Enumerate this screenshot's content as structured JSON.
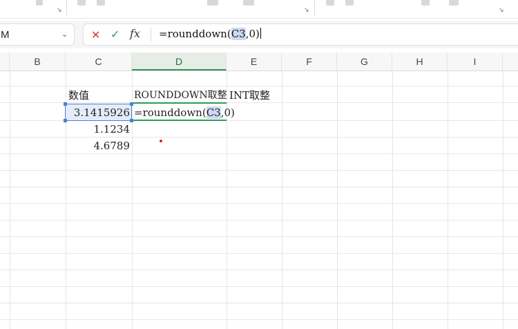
{
  "namebox": {
    "value": "M",
    "chevron_icon": "chevron-down-icon"
  },
  "formula_bar": {
    "cancel_icon": "x-icon",
    "confirm_icon": "check-icon",
    "fx_label": "fx",
    "formula_prefix": "=rounddown(",
    "formula_ref": "C3",
    "formula_suffix": ",0)"
  },
  "columns": [
    "B",
    "C",
    "D",
    "E",
    "F",
    "G",
    "H",
    "I"
  ],
  "active_column": "D",
  "cells": {
    "c_header": "数值",
    "d_header": "ROUNDDOWN取整",
    "e_header": "INT取整",
    "c3": "3.1415926",
    "c4": "1.1234",
    "c5": "4.6789",
    "d3_prefix": "=rounddown(",
    "d3_ref": "C3",
    "d3_suffix": ",0)"
  },
  "colors": {
    "selection": "#4a7ed6",
    "edit_accent": "#2e9b4e",
    "ref_highlight": "#cdd9f2"
  }
}
